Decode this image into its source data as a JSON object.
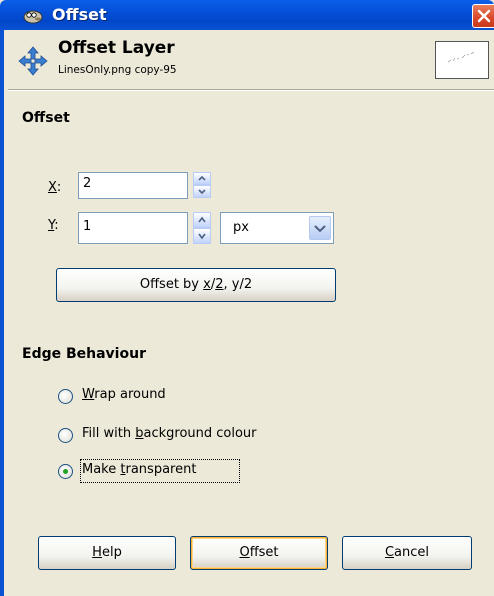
{
  "window": {
    "title": "Offset"
  },
  "header": {
    "title": "Offset Layer",
    "subtitle": "LinesOnly.png copy-95"
  },
  "offset_section": {
    "heading": "Offset",
    "x": {
      "mnemonic": "X",
      "rest": ":",
      "value": "2"
    },
    "y": {
      "mnemonic": "Y",
      "rest": ":",
      "value": "1"
    },
    "unit": "px",
    "half_button": {
      "pre": "Offset by ",
      "m1": "x",
      "mid": "/",
      "m2": "2",
      "post": ", y/2"
    }
  },
  "edge_section": {
    "heading": "Edge Behaviour",
    "options": [
      {
        "mnemonic": "W",
        "rest": "rap around",
        "selected": false
      },
      {
        "pre": "Fill with ",
        "mnemonic": "b",
        "rest": "ackground colour",
        "selected": false
      },
      {
        "pre": "Make ",
        "mnemonic": "t",
        "rest": "ransparent",
        "selected": true
      }
    ]
  },
  "buttons": {
    "help": {
      "mnemonic": "H",
      "rest": "elp"
    },
    "offset": {
      "mnemonic": "O",
      "rest": "ffset"
    },
    "cancel": {
      "mnemonic": "C",
      "rest": "ancel"
    }
  },
  "colors": {
    "titlebar": "#0A52D2",
    "dialog_bg": "#ECE9D8",
    "radio_dot": "#21A121"
  }
}
